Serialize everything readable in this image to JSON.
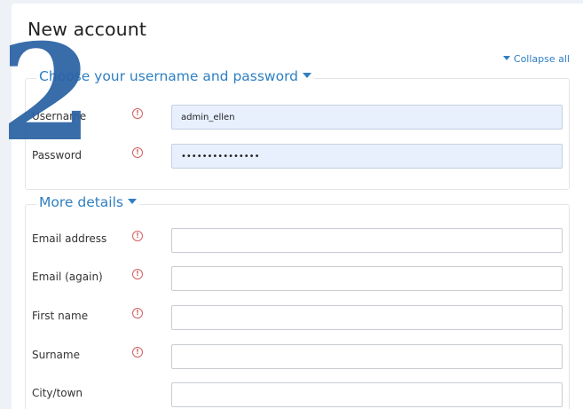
{
  "page": {
    "title": "New account",
    "step_number": "2",
    "collapse_all": "Collapse all"
  },
  "sections": {
    "credentials": {
      "legend": "Choose your username and password",
      "fields": {
        "username": {
          "label": "Username",
          "value": "admin_ellen",
          "required_icon": "!"
        },
        "password": {
          "label": "Password",
          "value": "•••••••••••••••",
          "required_icon": "!"
        }
      }
    },
    "details": {
      "legend": "More details",
      "fields": {
        "email": {
          "label": "Email address",
          "value": "",
          "required_icon": "!"
        },
        "email_again": {
          "label": "Email (again)",
          "value": "",
          "required_icon": "!"
        },
        "first_name": {
          "label": "First name",
          "value": "",
          "required_icon": "!"
        },
        "surname": {
          "label": "Surname",
          "value": "",
          "required_icon": "!"
        },
        "city": {
          "label": "City/town",
          "value": ""
        }
      }
    }
  },
  "colors": {
    "accent": "#2f7fc2",
    "required": "#d06060",
    "autofill_bg": "#e8f0fe",
    "overlay_number": "#2a62a4"
  },
  "icons": {
    "required": "exclamation-circle-icon",
    "expand": "caret-down-icon"
  }
}
